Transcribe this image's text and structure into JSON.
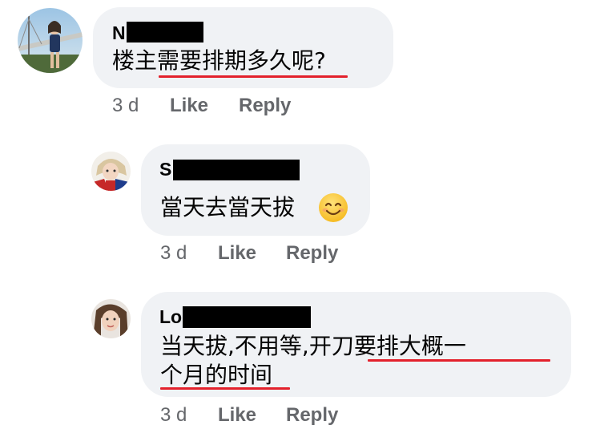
{
  "comments": [
    {
      "author_visible": "N",
      "text_pre": "楼主",
      "text_underlined": "需要排期多久呢",
      "text_post": "?",
      "time": "3 d",
      "like_label": "Like",
      "reply_label": "Reply"
    },
    {
      "author_visible": "S",
      "text": "當天去當天拔",
      "emoji": "smiling-face-emoji",
      "time": "3 d",
      "like_label": "Like",
      "reply_label": "Reply"
    },
    {
      "author_visible": "Lo",
      "line1_plain": "当天拔,不用等,",
      "line1_underlined": "开刀要排大概一",
      "line2_underlined": "个月的时间",
      "time": "3 d",
      "like_label": "Like",
      "reply_label": "Reply"
    }
  ],
  "colors": {
    "bubble": "#f0f2f5",
    "meta_text": "#65676b",
    "underline": "#e3212c",
    "redaction": "#000000"
  }
}
